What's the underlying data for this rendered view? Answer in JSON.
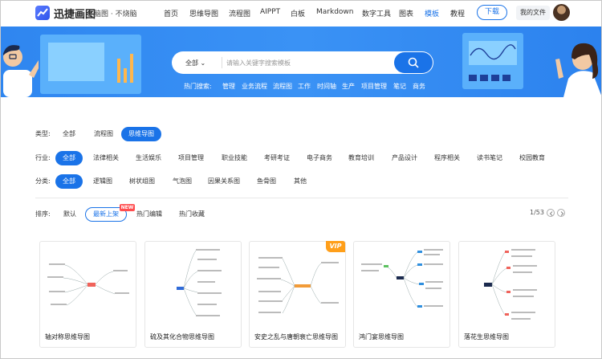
{
  "brand": {
    "name": "迅捷画图",
    "sub": "脑图 · 不烧脑"
  },
  "nav": {
    "items": [
      "首页",
      "思维导图",
      "流程图",
      "AIPPT",
      "白板",
      "Markdown",
      "数字工具",
      "图表",
      "模板",
      "教程"
    ],
    "active_index": 8
  },
  "header": {
    "download_label": "下载",
    "files_label": "我的文件"
  },
  "search": {
    "select_label": "全部",
    "placeholder": "请输入关键字搜索模板"
  },
  "hot": {
    "label": "热门搜索:",
    "items": [
      "管理",
      "业务流程",
      "流程图",
      "工作",
      "时间轴",
      "生产",
      "项目管理",
      "笔记",
      "商务"
    ]
  },
  "filters": {
    "type": {
      "label": "类型:",
      "options": [
        "全部",
        "流程图",
        "思维导图"
      ],
      "selected_index": 2
    },
    "industry": {
      "label": "行业:",
      "options": [
        "全部",
        "法律相关",
        "生活娱乐",
        "项目管理",
        "职业技能",
        "考研考证",
        "电子商务",
        "教育培训",
        "产品设计",
        "程序相关",
        "读书笔记",
        "校园教育"
      ],
      "selected_index": 0
    },
    "category": {
      "label": "分类:",
      "options": [
        "全部",
        "逻辑图",
        "树状组图",
        "气泡图",
        "因果关系图",
        "鱼骨图",
        "其他"
      ],
      "selected_index": 0
    }
  },
  "sort": {
    "label": "排序:",
    "options": [
      "默认",
      "最新上架",
      "热门编辑",
      "热门收藏"
    ],
    "selected_index": 1,
    "new_badge": "NEW"
  },
  "pager": {
    "text": "1/53"
  },
  "cards": [
    {
      "title": "轴对称思维导图",
      "vip": false
    },
    {
      "title": "硫及其化合物思维导图",
      "vip": false
    },
    {
      "title": "安史之乱与唐朝衰亡思维导图",
      "vip": true,
      "vip_label": "VIP"
    },
    {
      "title": "鸿门宴思维导图",
      "vip": false
    },
    {
      "title": "落花生思维导图",
      "vip": false
    }
  ],
  "colors": {
    "accent": "#1a73e8",
    "banner": "#3a92f5",
    "vip": "#ff9f1a",
    "new": "#ff4d4f"
  }
}
